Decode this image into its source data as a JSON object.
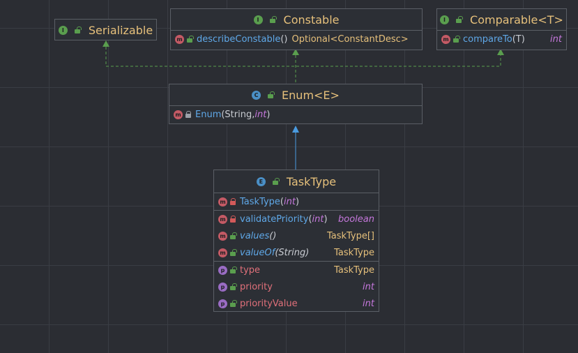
{
  "diagram": {
    "serializable": {
      "title": "Serializable",
      "badge": "I"
    },
    "constable": {
      "title": "Constable",
      "badge": "I",
      "methods": [
        {
          "badge": "m",
          "name": "describeConstable",
          "params": "()",
          "type": "Optional<ConstantDesc>"
        }
      ]
    },
    "comparable": {
      "title": "Comparable<T>",
      "badge": "I",
      "methods": [
        {
          "badge": "m",
          "name": "compareTo",
          "params": "(T)",
          "type": "int"
        }
      ]
    },
    "enum": {
      "title": "Enum<E>",
      "badge": "C",
      "methods": [
        {
          "badge": "m",
          "name": "Enum",
          "params_prefix": "(String, ",
          "params_kw": "int",
          "params_suffix": ")"
        }
      ]
    },
    "tasktype": {
      "title": "TaskType",
      "badge": "E",
      "constructor": {
        "badge": "m",
        "name": "TaskType",
        "params_prefix": "(",
        "params_kw": "int",
        "params_suffix": ")"
      },
      "methods": [
        {
          "badge": "m",
          "name": "validatePriority",
          "params_prefix": "(",
          "params_kw": "int",
          "params_suffix": ")",
          "type": "boolean"
        },
        {
          "badge": "m",
          "name": "values",
          "params": "()",
          "type": "TaskType[]"
        },
        {
          "badge": "m",
          "name": "valueOf",
          "params": "(String)",
          "type": "TaskType"
        }
      ],
      "fields": [
        {
          "badge": "p",
          "name": "type",
          "type": "TaskType"
        },
        {
          "badge": "p",
          "name": "priority",
          "type": "int"
        },
        {
          "badge": "p",
          "name": "priorityValue",
          "type": "int"
        }
      ]
    }
  }
}
